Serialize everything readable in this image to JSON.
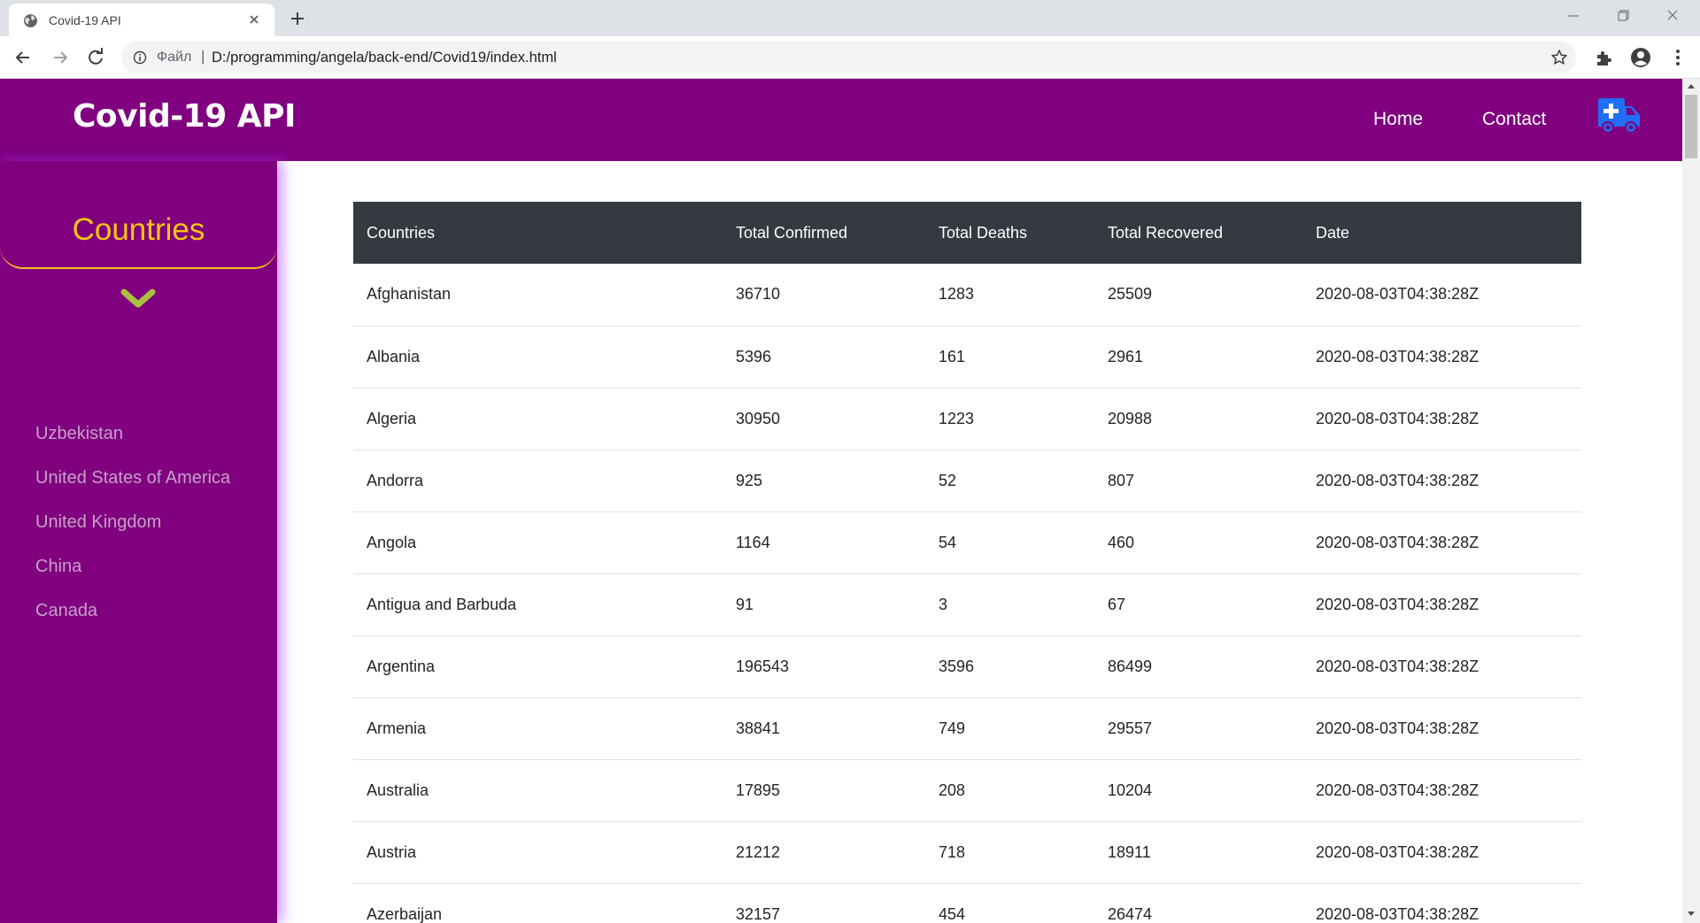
{
  "browser": {
    "tab_title": "Covid-19 API",
    "url_label": "Файл",
    "url_separator": "|",
    "url": "D:/programming/angela/back-end/Covid19/index.html"
  },
  "navbar": {
    "brand": "Covid-19 API",
    "links": [
      "Home",
      "Contact"
    ],
    "icon": "ambulance-icon"
  },
  "sidebar": {
    "title": "Countries",
    "icon": "chevron-down-icon",
    "items": [
      "Uzbekistan",
      "United States of America",
      "United Kingdom",
      "China",
      "Canada"
    ]
  },
  "table": {
    "headers": [
      "Countries",
      "Total Confirmed",
      "Total Deaths",
      "Total Recovered",
      "Date"
    ],
    "rows": [
      [
        "Afghanistan",
        "36710",
        "1283",
        "25509",
        "2020-08-03T04:38:28Z"
      ],
      [
        "Albania",
        "5396",
        "161",
        "2961",
        "2020-08-03T04:38:28Z"
      ],
      [
        "Algeria",
        "30950",
        "1223",
        "20988",
        "2020-08-03T04:38:28Z"
      ],
      [
        "Andorra",
        "925",
        "52",
        "807",
        "2020-08-03T04:38:28Z"
      ],
      [
        "Angola",
        "1164",
        "54",
        "460",
        "2020-08-03T04:38:28Z"
      ],
      [
        "Antigua and Barbuda",
        "91",
        "3",
        "67",
        "2020-08-03T04:38:28Z"
      ],
      [
        "Argentina",
        "196543",
        "3596",
        "86499",
        "2020-08-03T04:38:28Z"
      ],
      [
        "Armenia",
        "38841",
        "749",
        "29557",
        "2020-08-03T04:38:28Z"
      ],
      [
        "Australia",
        "17895",
        "208",
        "10204",
        "2020-08-03T04:38:28Z"
      ],
      [
        "Austria",
        "21212",
        "718",
        "18911",
        "2020-08-03T04:38:28Z"
      ],
      [
        "Azerbaijan",
        "32157",
        "454",
        "26474",
        "2020-08-03T04:38:28Z"
      ]
    ]
  },
  "colors": {
    "primary_purple": "#800080",
    "accent_yellow": "#f7c40f",
    "table_header": "#343a40",
    "ambulance_blue": "#1e6ff5",
    "chevron_green": "#a9c23f"
  }
}
